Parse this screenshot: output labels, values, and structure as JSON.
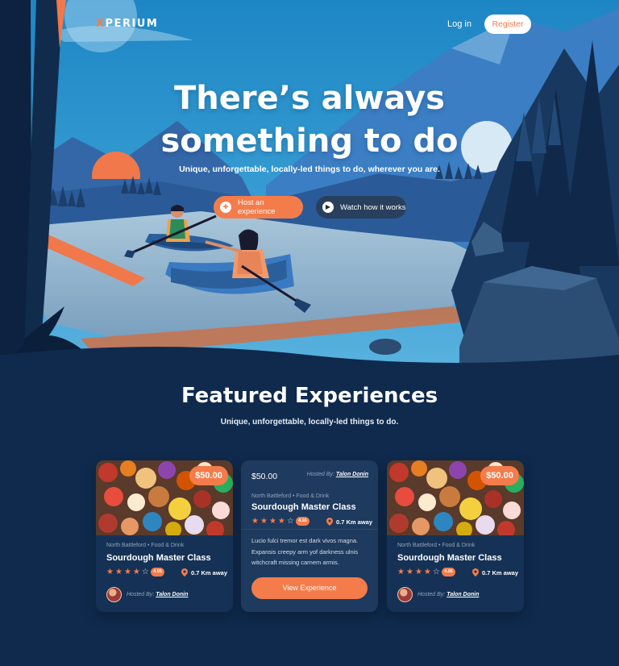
{
  "nav": {
    "logo_x": "X",
    "logo_rest": "PERIUM",
    "login_label": "Log in",
    "register_label": "Register"
  },
  "hero": {
    "title_line1": "There’s always",
    "title_line2": "something to do",
    "subtitle": "Unique, unforgettable, locally-led things to do, wherever you are.",
    "host_button": "Host an experience",
    "watch_button": "Watch how it works"
  },
  "featured": {
    "title": "Featured Experiences",
    "subtitle": "Unique, unforgettable, locally-led things to do."
  },
  "cards": [
    {
      "price": "$50.00",
      "meta": "North Battleford • Food & Drink",
      "title": "Sourdough Master Class",
      "rating": "4.95",
      "stars_filled": 4,
      "distance": "0.7 Km away",
      "hosted_prefix": "Hosted By:",
      "host": "Talon Donin"
    },
    {
      "price": "$50.00",
      "hosted_prefix": "Hosted By:",
      "host": "Talon Donin",
      "meta": "North Battleford • Food & Drink",
      "title": "Sourdough Master Class",
      "rating": "4.95",
      "stars_filled": 4,
      "distance": "0.7 Km away",
      "description": "Lucio fulci tremor est dark vivos magna. Expansis creepy arm yof darkness ulnis witchcraft missing carnem armis.",
      "button": "View Experience"
    },
    {
      "price": "$50.00",
      "meta": "North Battleford • Food & Drink",
      "title": "Sourdough Master Class",
      "rating": "4.95",
      "stars_filled": 4,
      "distance": "0.7 Km away",
      "hosted_prefix": "Hosted By:",
      "host": "Talon Donin"
    }
  ],
  "icons": {
    "host_button_icon": "plus-icon",
    "watch_button_icon": "play-icon",
    "distance_icon": "location-pin-icon",
    "star_icon": "star-icon"
  },
  "colors": {
    "accent": "#f47c4a",
    "background": "#0f2a4d",
    "card": "#153256",
    "sky": "#2a8cc7"
  }
}
